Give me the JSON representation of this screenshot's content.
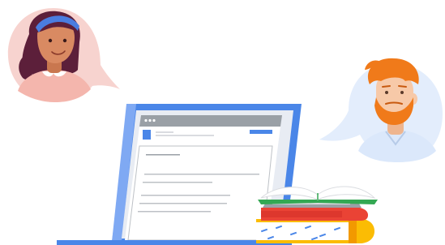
{
  "scene": {
    "colors": {
      "laptop_blue": "#4a86e8",
      "laptop_blue_light": "#7fa9f3",
      "screen_bg": "#e8ecf3",
      "window_bg": "#ffffff",
      "window_bar": "#9aa0a6",
      "line_gray": "#bdc1c6",
      "book_green": "#34a853",
      "book_red": "#ea4335",
      "book_yellow": "#fbbc04",
      "skin_woman": "#d98a62",
      "hair_woman": "#5c1f3a",
      "headband": "#4a7de0",
      "shirt_woman": "#f4b6ad",
      "bubble_woman": "#f7d3cf",
      "hair_man": "#f07a1a",
      "skin_man": "#f7c9a8",
      "shirt_man": "#dbe8fb",
      "bubble_man": "#e3edfc"
    },
    "icons": {
      "woman": "woman-avatar-icon",
      "man": "man-avatar-icon",
      "laptop": "laptop-icon",
      "books": "book-stack-icon",
      "window_dots": "window-controls-icon"
    }
  }
}
